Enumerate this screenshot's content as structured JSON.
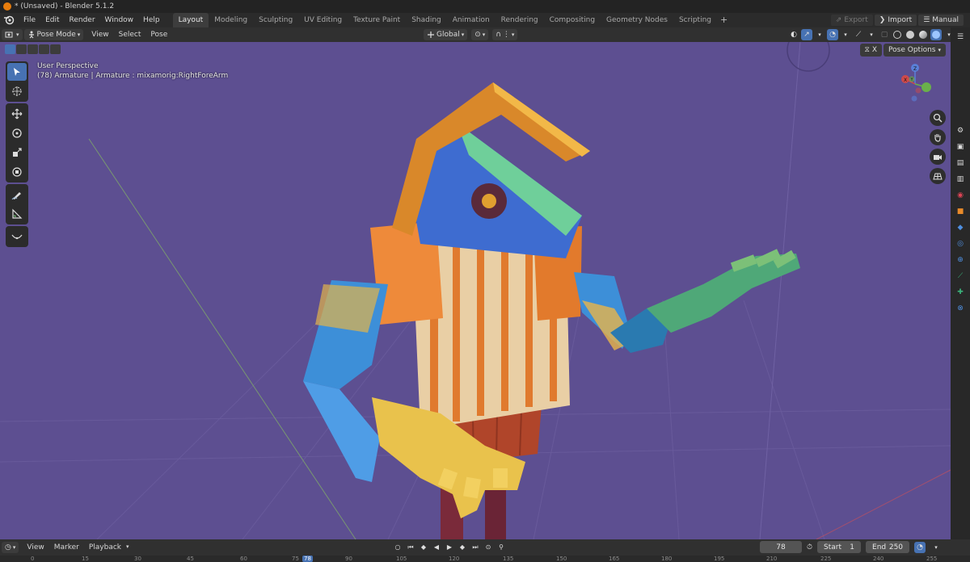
{
  "window": {
    "title": "* (Unsaved) - Blender 5.1.2"
  },
  "menu": [
    "File",
    "Edit",
    "Render",
    "Window",
    "Help"
  ],
  "workspaces": [
    "Layout",
    "Modeling",
    "Sculpting",
    "UV Editing",
    "Texture Paint",
    "Shading",
    "Animation",
    "Rendering",
    "Compositing",
    "Geometry Nodes",
    "Scripting"
  ],
  "active_workspace": "Layout",
  "top_right": {
    "export": "Export",
    "import": "Import",
    "manual": "Manual"
  },
  "viewport_header": {
    "mode": "Pose Mode",
    "menus": [
      "View",
      "Select",
      "Pose"
    ],
    "orientation": "Global"
  },
  "viewport": {
    "perspective": "User Perspective",
    "object_info": "(78) Armature | Armature : mixamorig:RightForeArm",
    "pose_options": "Pose Options",
    "close_label": "X"
  },
  "gizmo": {
    "axes": [
      "X",
      "Y",
      "Z"
    ]
  },
  "timeline": {
    "menus": [
      "View",
      "Marker",
      "Playback"
    ],
    "current_frame": "78",
    "start_label": "Start",
    "start": "1",
    "end_label": "End",
    "end": "250",
    "ruler": [
      "0",
      "15",
      "30",
      "45",
      "60",
      "75",
      "78",
      "90",
      "105",
      "120",
      "135",
      "150",
      "165",
      "180",
      "195",
      "210",
      "225",
      "240",
      "255"
    ]
  },
  "colors": {
    "accent": "#4772b3",
    "viewport_bg": "#5d4f91",
    "header": "#303030"
  }
}
